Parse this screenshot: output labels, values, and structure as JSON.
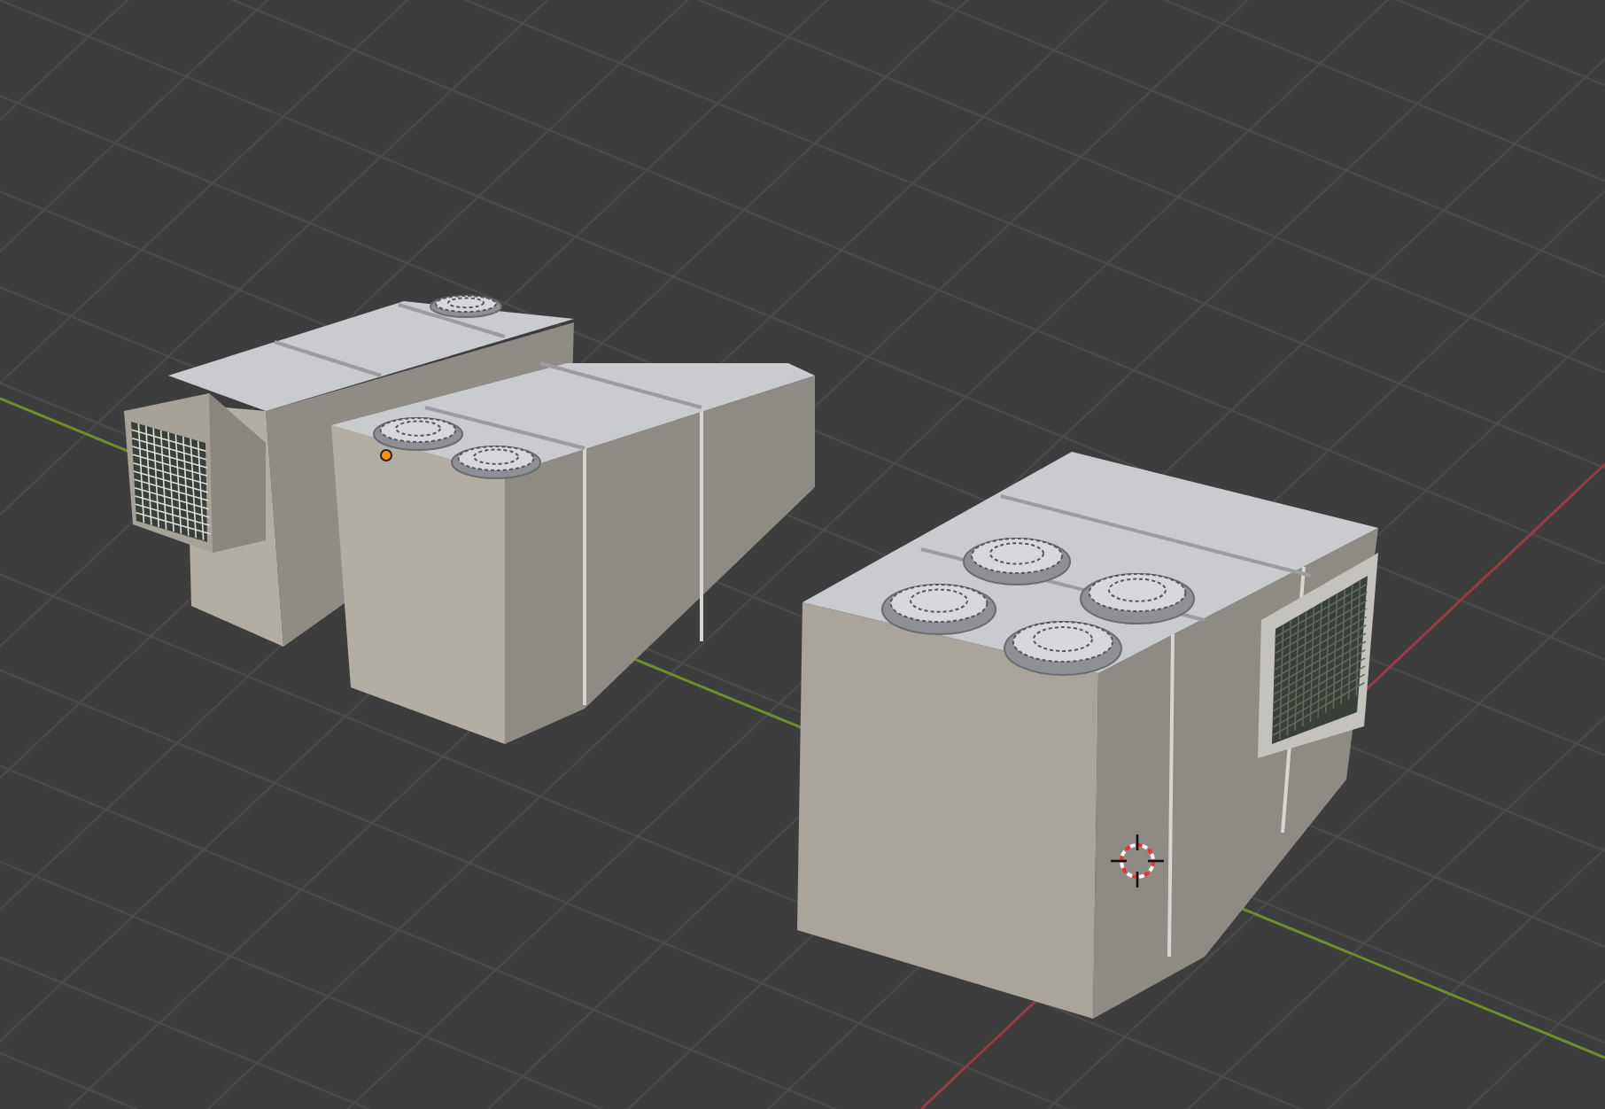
{
  "viewport": {
    "axes": true,
    "cursor": true,
    "origin_marker": true,
    "objects": [
      {
        "kind": "unit-small"
      },
      {
        "kind": "unit-medium"
      },
      {
        "kind": "unit-large"
      }
    ]
  }
}
